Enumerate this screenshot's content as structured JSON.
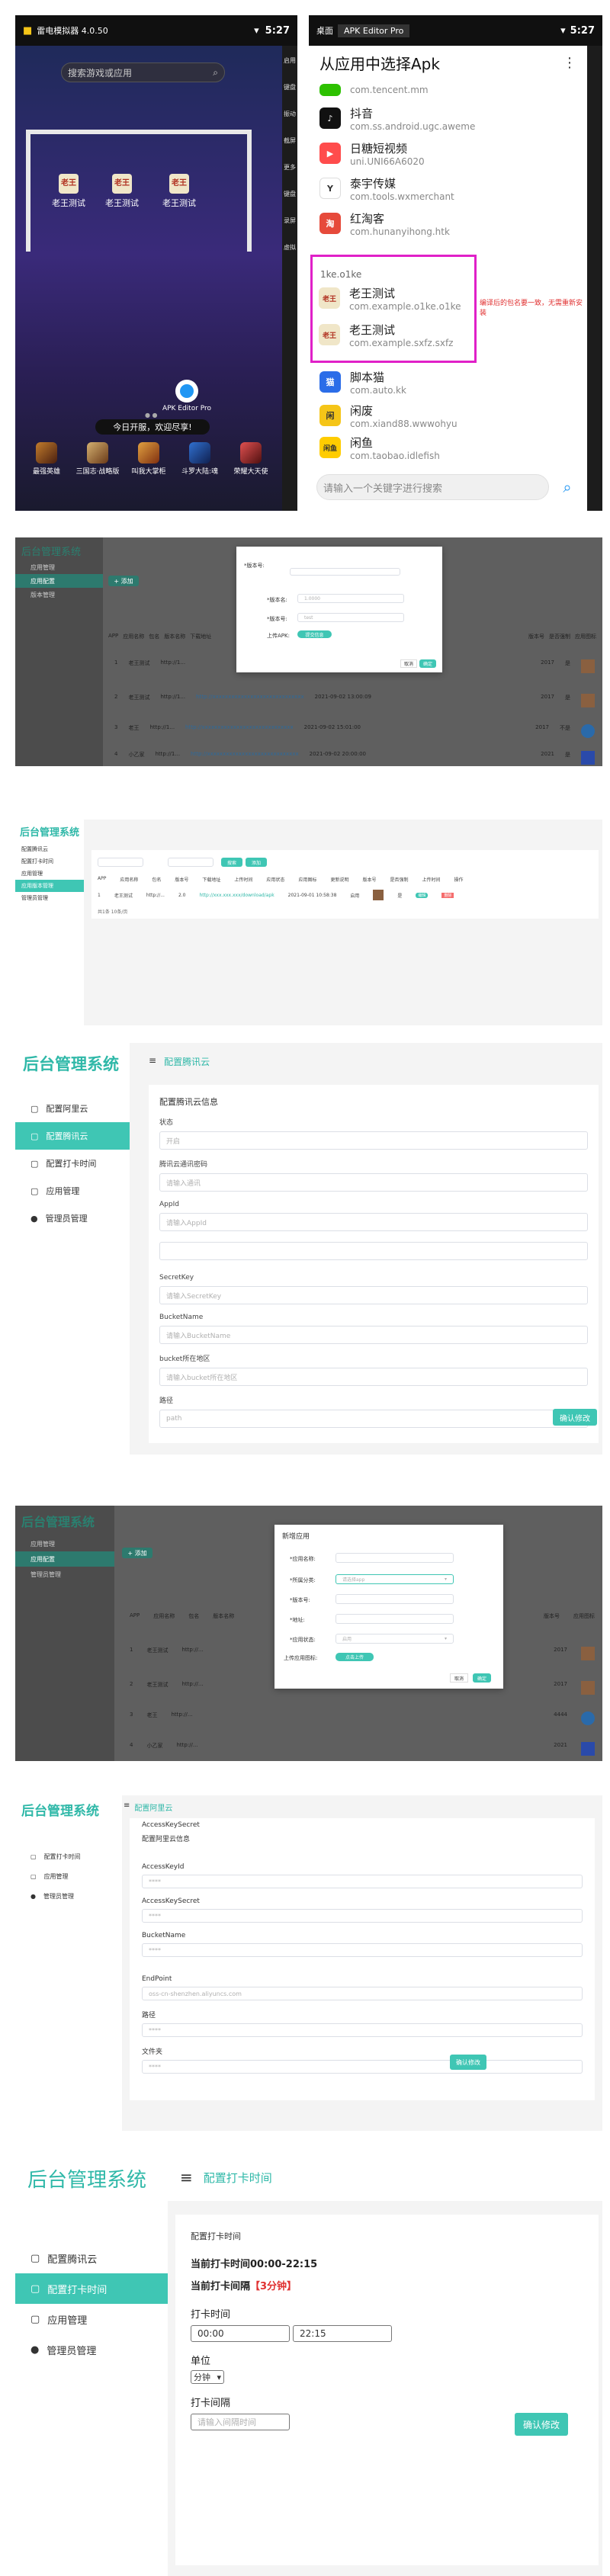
{
  "phone_left": {
    "window_title": "雷电模拟器 4.0.50",
    "time": "5:27",
    "search_placeholder": "搜索游戏或应用",
    "desktop_apps": [
      {
        "label": "老王测试"
      },
      {
        "label": "老王测试"
      },
      {
        "label": "老王测试"
      }
    ],
    "apk_editor_label": "APK Editor Pro",
    "toast": "今日开服，欢迎尽享!",
    "dock_apps": [
      {
        "label": "最强英雄"
      },
      {
        "label": "三国志·战略版"
      },
      {
        "label": "叫我大掌柜"
      },
      {
        "label": "斗罗大陆:魂"
      },
      {
        "label": "荣耀大天使"
      }
    ],
    "side_buttons": [
      "启用",
      "键盘",
      "振动",
      "截屏",
      "更多",
      "键盘",
      "录屏",
      "虚拟"
    ]
  },
  "phone_right": {
    "tabs": [
      "桌面",
      "APK Editor Pro"
    ],
    "time": "5:27",
    "header": "从应用中选择Apk",
    "apps": [
      {
        "name": "",
        "pkg": "com.tencent.mm",
        "icon_color": "#2dc100"
      },
      {
        "name": "抖音",
        "pkg": "com.ss.android.ugc.aweme",
        "icon_color": "#111111"
      },
      {
        "name": "日糖短视频",
        "pkg": "uni.UNI66A6020",
        "icon_color": "#ff4c4c"
      },
      {
        "name": "泰宇传媒",
        "pkg": "com.tools.wxmerchant",
        "icon_color": "#444444"
      },
      {
        "name": "红淘客",
        "pkg": "com.hunanyihong.htk",
        "icon_color": "#e64a3b"
      }
    ],
    "highlight_header": "1ke.o1ke",
    "highlight_apps": [
      {
        "name": "老王测试",
        "pkg": "com.example.o1ke.o1ke"
      },
      {
        "name": "老王测试",
        "pkg": "com.example.sxfz.sxfz"
      }
    ],
    "annotation": "编译后的包名要一致，无需重新安装",
    "apps_after": [
      {
        "name": "脚本猫",
        "pkg": "com.auto.kk",
        "icon_color": "#2b6de8"
      },
      {
        "name": "闲废",
        "pkg": "com.xiand88.wwwohyu",
        "icon_color": "#f5c518"
      },
      {
        "name": "闲鱼",
        "pkg": "com.taobao.idlefish",
        "icon_color": "#ffcc00"
      }
    ],
    "search_placeholder": "请输入一个关键字进行搜索"
  },
  "colors": {
    "teal": "#3fc6b4",
    "magenta": "#e020c8",
    "dark_bg": "#5f5f5f"
  },
  "panel2": {
    "modal_fields": [
      "*版本号:",
      "*版本名:",
      "*版本号:",
      "上传APK:"
    ],
    "modal_value1": "1.0000",
    "modal_value2": "test",
    "modal_button": "提交信息",
    "modal_cancel": "取消",
    "modal_ok": "确定",
    "add_button": "+ 添加",
    "table_headers": [
      "APP",
      "应用名称",
      "包名",
      "版本名称",
      "下载地址",
      "",
      "创建时间",
      "发布时间",
      "更新说明",
      "版本号",
      "是否强制",
      "应用图标"
    ],
    "rows": [
      {
        "id": "1",
        "name": "老王测试",
        "pkg": "http://1...",
        "url": "http://xxxxxxxxxxxxxxxxxxxxxxxxxxxxx",
        "date": "2021-09-01 10:58:38",
        "ver": "2017",
        "force": "是"
      },
      {
        "id": "2",
        "name": "老王测试",
        "pkg": "http://1...",
        "url": "http://xxxxxxxxxxxxxxxxxxxxxxxxxxxxx",
        "date": "2021-09-02 13:00:09",
        "ver": "2017",
        "force": "是"
      },
      {
        "id": "3",
        "name": "老王",
        "pkg": "http://1...",
        "url": "http://xxxxxxxxxxxxxxxxxxxxxxxxxxxxx",
        "date": "2021-09-02 15:01:00",
        "ver": "2017",
        "force": "不是"
      },
      {
        "id": "4",
        "name": "小乙家",
        "pkg": "http://1...",
        "url": "http://xxxxxxxxxxxxxxxxxxxxxxxxxxxxx",
        "date": "2021-09-02 20:00:00",
        "ver": "2021",
        "force": "是"
      }
    ],
    "sidebar": [
      "应用管理",
      "应用配置",
      "版本管理"
    ]
  },
  "panel3": {
    "title": "后台管理系统",
    "sidebar": [
      "配置腾讯云",
      "配置打卡时间",
      "应用管理",
      "应用版本管理",
      "管理员管理"
    ],
    "search_btn": "搜索",
    "add_btn": "添加",
    "headers": [
      "APP",
      "应用名称",
      "包名",
      "版本号",
      "下载地址",
      "",
      "上传时间",
      "应用状态",
      "应用图标",
      "更新说明",
      "版本号",
      "是否强制",
      "上传时间",
      "操作"
    ],
    "row": {
      "id": "1",
      "name": "老王测试",
      "pkg": "http://...",
      "ver": "2.0",
      "url": "http://xxx.xxx.xxx/download/apk",
      "date": "2021-09-01 10:58:38",
      "status": "启用",
      "force": "是",
      "edit": "编辑",
      "del": "删除"
    },
    "pagination": "共1条 10条/页"
  },
  "panel4": {
    "title": "后台管理系统",
    "breadcrumb": "配置腾讯云",
    "sidebar": [
      "配置阿里云",
      "配置腾讯云",
      "配置打卡时间",
      "应用管理",
      "管理员管理"
    ],
    "section_title": "配置腾讯云信息",
    "fields": [
      {
        "label": "状态",
        "placeholder": "开启"
      },
      {
        "label": "腾讯云通讯密码",
        "placeholder": "请输入通讯"
      },
      {
        "label": "AppId",
        "placeholder": "请输入AppId"
      },
      {
        "label": "",
        "placeholder": ""
      },
      {
        "label": "SecretKey",
        "placeholder": "请输入SecretKey"
      },
      {
        "label": "BucketName",
        "placeholder": "请输入BucketName"
      },
      {
        "label": "bucket所在地区",
        "placeholder": "请输入bucket所在地区"
      },
      {
        "label": "路径",
        "placeholder": "path"
      }
    ],
    "submit": "确认修改"
  },
  "panel5": {
    "title": "后台管理系统",
    "sidebar": [
      "应用管理",
      "应用配置",
      "管理员管理"
    ],
    "modal_title": "新增应用",
    "modal_fields": [
      "*应用名称:",
      "*所属分类:",
      "*版本号:",
      "*地址:",
      "*应用状态:",
      "上传应用图标:"
    ],
    "modal_select": "请选择app",
    "modal_status": "启用",
    "modal_upload": "点击上传",
    "modal_cancel": "取消",
    "modal_ok": "确定",
    "add_button": "+ 添加",
    "headers": [
      "APP",
      "应用名称",
      "包名",
      "版本名称",
      "",
      "",
      "",
      "",
      "",
      "",
      "",
      "",
      "版本号",
      "应用图标"
    ],
    "rows": [
      {
        "id": "1",
        "name": "老王测试",
        "pkg": "http://...",
        "ver": "2017"
      },
      {
        "id": "2",
        "name": "老王测试",
        "pkg": "http://...",
        "ver": "2017"
      },
      {
        "id": "3",
        "name": "老王",
        "pkg": "http://...",
        "ver": "4444"
      },
      {
        "id": "4",
        "name": "小乙家",
        "pkg": "http://...",
        "ver": "2021"
      }
    ]
  },
  "panel6": {
    "title": "后台管理系统",
    "breadcrumb": "配置阿里云",
    "sidebar": [
      "配置打卡时间",
      "应用管理",
      "管理员管理"
    ],
    "top_label": "AccessKeySecret",
    "section_title": "配置阿里云信息",
    "fields": [
      {
        "label": "AccessKeyId",
        "placeholder": "****"
      },
      {
        "label": "AccessKeySecret",
        "placeholder": "****"
      },
      {
        "label": "BucketName",
        "placeholder": "****"
      },
      {
        "label": "EndPoint",
        "placeholder": "oss-cn-shenzhen.aliyuncs.com"
      },
      {
        "label": "路径",
        "placeholder": "****"
      },
      {
        "label": "文件夹",
        "placeholder": "****"
      }
    ],
    "submit": "确认修改"
  },
  "panel7": {
    "title": "后台管理系统",
    "breadcrumb": "配置打卡时间",
    "sidebar": [
      "配置腾讯云",
      "配置打卡时间",
      "应用管理",
      "管理员管理"
    ],
    "section_title": "配置打卡时间",
    "current_time_label": "当前打卡时间00:00-22:15",
    "current_interval_label": "当前打卡间隔",
    "current_interval_value": "【3分钟】",
    "time_label": "打卡时间",
    "start_time": "00:00",
    "end_time": "22:15",
    "unit_label": "单位",
    "unit_value": "分钟",
    "interval_label": "打卡间隔",
    "interval_placeholder": "请输入间隔时间",
    "submit": "确认修改"
  }
}
